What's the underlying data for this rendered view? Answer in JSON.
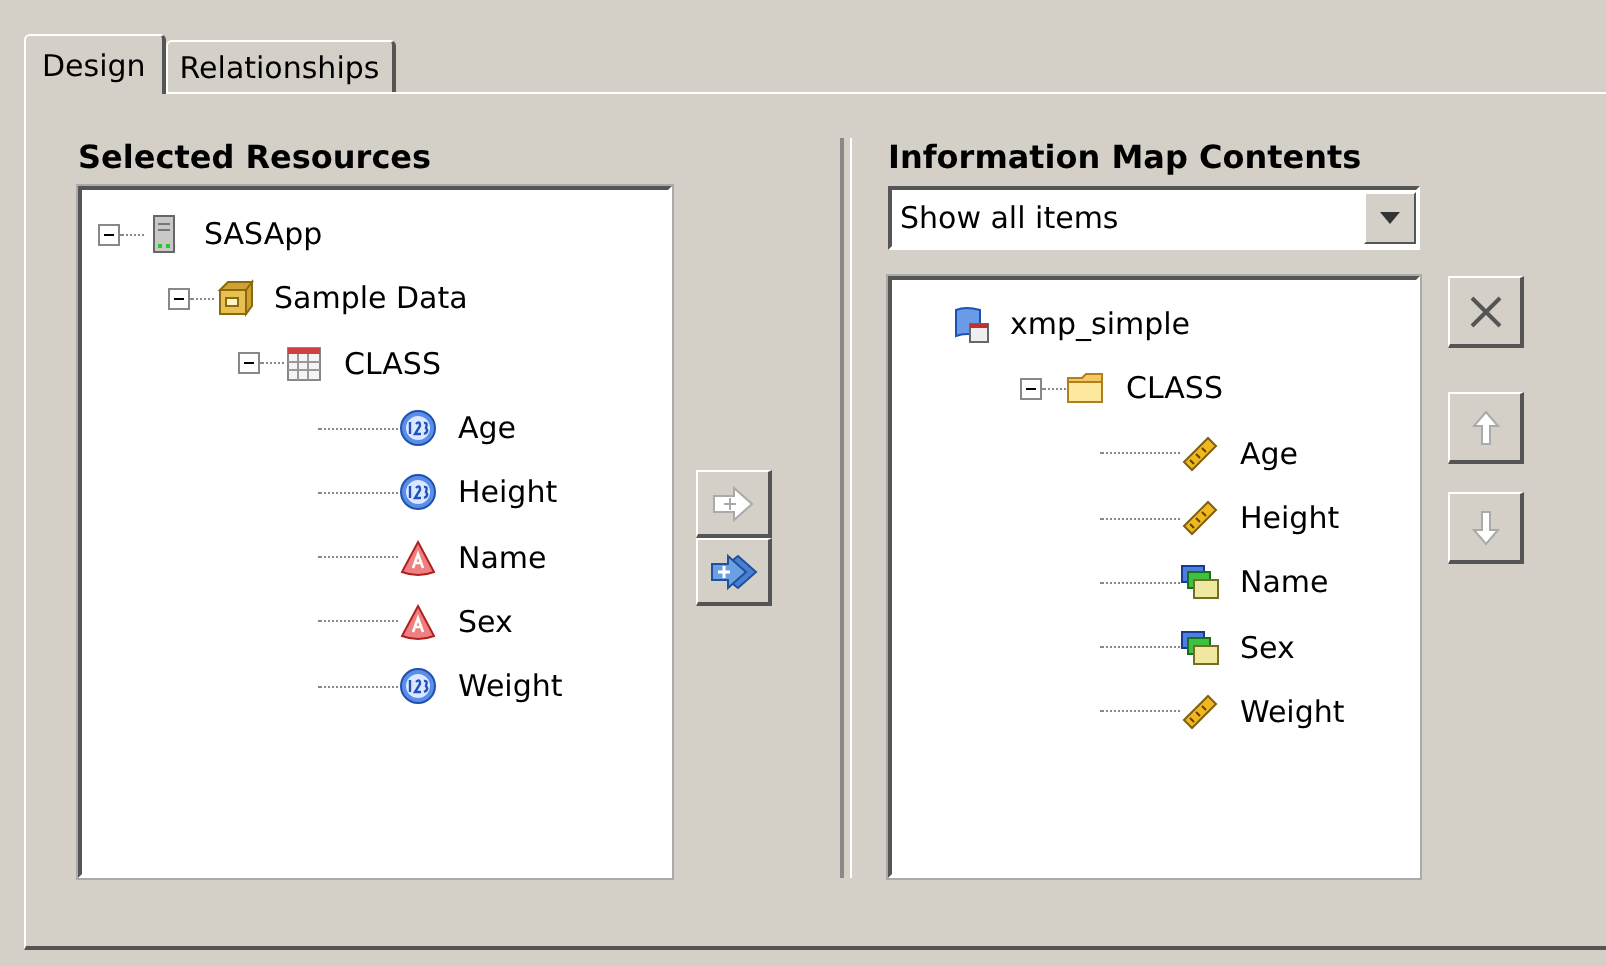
{
  "tabs": [
    {
      "label": "Design",
      "selected": true
    },
    {
      "label": "Relationships",
      "selected": false
    }
  ],
  "selected_resources": {
    "title": "Selected Resources",
    "tree": [
      {
        "label": "SASApp",
        "kind": "server",
        "expanded": true,
        "children": [
          {
            "label": "Sample Data",
            "kind": "library",
            "expanded": true,
            "children": [
              {
                "label": "CLASS",
                "kind": "table",
                "expanded": true,
                "children": [
                  {
                    "label": "Age",
                    "kind": "numeric"
                  },
                  {
                    "label": "Height",
                    "kind": "numeric"
                  },
                  {
                    "label": "Name",
                    "kind": "character"
                  },
                  {
                    "label": "Sex",
                    "kind": "character"
                  },
                  {
                    "label": "Weight",
                    "kind": "numeric"
                  }
                ]
              }
            ]
          }
        ]
      }
    ]
  },
  "transfer_buttons": [
    {
      "kind": "add",
      "disabled": true
    },
    {
      "kind": "add-all",
      "disabled": false
    }
  ],
  "information_map_contents": {
    "title": "Information Map Contents",
    "filter": {
      "value": "Show all items"
    },
    "tree": [
      {
        "label": "xmp_simple",
        "kind": "infomap",
        "children": [
          {
            "label": "CLASS",
            "kind": "folder",
            "expanded": true,
            "children": [
              {
                "label": "Age",
                "kind": "measure"
              },
              {
                "label": "Height",
                "kind": "measure"
              },
              {
                "label": "Name",
                "kind": "category"
              },
              {
                "label": "Sex",
                "kind": "category"
              },
              {
                "label": "Weight",
                "kind": "measure"
              }
            ]
          }
        ]
      }
    ]
  },
  "side_buttons": [
    {
      "kind": "delete",
      "disabled": false
    },
    {
      "kind": "move-up",
      "disabled": true
    },
    {
      "kind": "move-down",
      "disabled": true
    }
  ]
}
